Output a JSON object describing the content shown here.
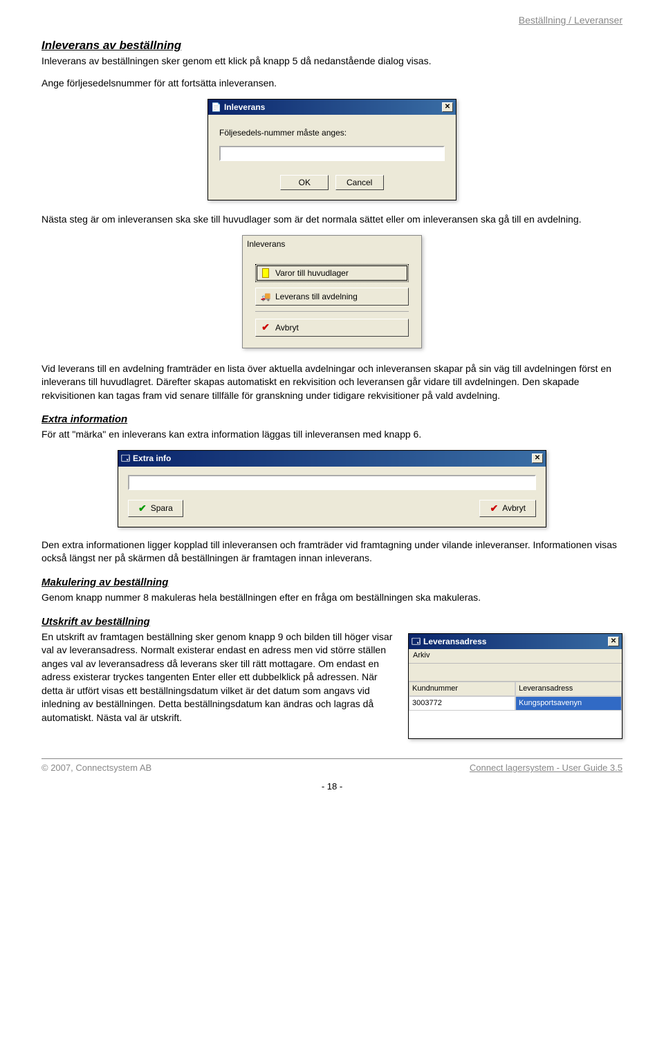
{
  "page_header": "Beställning / Leveranser",
  "h_inleverans": "Inleverans av beställning",
  "p_inleverans_1": "Inleverans av beställningen sker genom ett klick på knapp 5 då nedanstående dialog visas.",
  "p_inleverans_2": "Ange förljesedelsnummer för att fortsätta inleveransen.",
  "dlg1": {
    "title": "Inleverans",
    "label": "Följesedels-nummer måste anges:",
    "ok": "OK",
    "cancel": "Cancel"
  },
  "p_after_dlg1": "Nästa steg är om inleveransen ska ske till huvudlager som är det normala sättet eller om inleveransen ska gå till en avdelning.",
  "dlg2": {
    "title": "Inleverans",
    "btn1": "Varor till huvudlager",
    "btn2": "Leverans till avdelning",
    "btn3": "Avbryt"
  },
  "p_after_dlg2": "Vid leverans till en avdelning framträder en lista över aktuella avdelningar och inleveransen skapar på sin väg till avdelningen först en inleverans till huvudlagret. Därefter skapas automatiskt en rekvisition och leveransen går vidare till avdelningen. Den skapade rekvisitionen kan tagas fram vid senare tillfälle för granskning under tidigare rekvisitioner på vald avdelning.",
  "h_extra": "Extra information",
  "p_extra": "För att \"märka\" en inleverans kan extra information läggas till inleveransen med knapp 6.",
  "dlg3": {
    "title": "Extra info",
    "save": "Spara",
    "cancel": "Avbryt"
  },
  "p_after_dlg3": "Den extra informationen ligger kopplad till inleveransen och framträder vid framtagning under vilande inleveranser. Informationen visas också längst ner på skärmen då beställningen är framtagen innan inleverans.",
  "h_makulering": "Makulering av beställning",
  "p_makulering": "Genom knapp nummer 8 makuleras hela beställningen efter en fråga om beställningen ska makuleras.",
  "h_utskrift": "Utskrift av beställning",
  "p_utskrift": "En utskrift av framtagen beställning sker genom knapp 9 och bilden till höger visar val av leveransadress. Normalt existerar endast en adress men vid större ställen anges val av leveransadress då leverans sker till rätt mottagare. Om endast en adress existerar tryckes tangenten Enter eller ett dubbelklick på adressen. När detta är utfört visas ett beställningsdatum vilket är det datum som angavs vid inledning av beställningen. Detta beställningsdatum kan ändras och lagras då automatiskt. Nästa val är utskrift.",
  "lev": {
    "title": "Leveransadress",
    "menu": "Arkiv",
    "col1": "Kundnummer",
    "col2": "Leveransadress",
    "row1_col1": "3003772",
    "row1_col2": "Kungsportsavenyn"
  },
  "footer": {
    "left": "© 2007, Connectsystem AB",
    "right": "Connect lagersystem - User Guide 3.5",
    "page": "- 18 -"
  }
}
